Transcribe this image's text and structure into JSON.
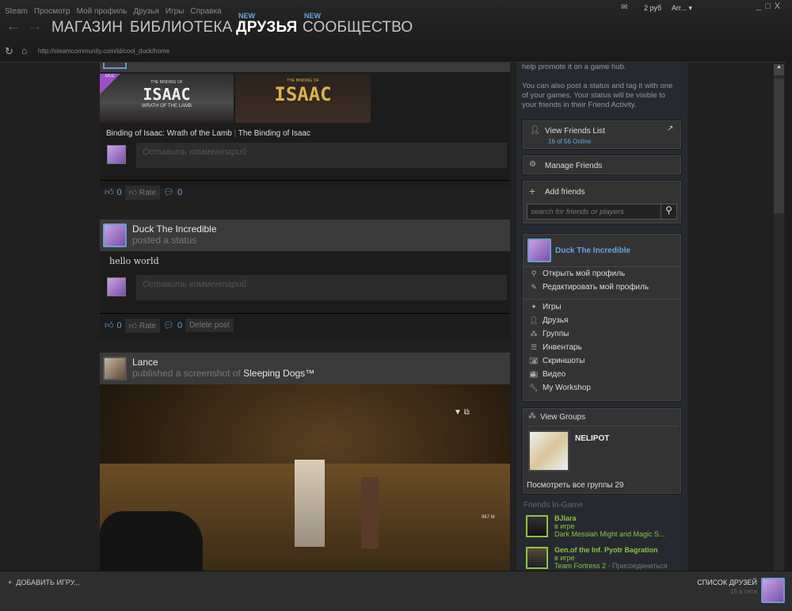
{
  "menu": [
    "Steam",
    "Просмотр",
    "Мой профиль",
    "Друзья",
    "Игры",
    "Справка"
  ],
  "wallet": "2 руб",
  "account": "Arr...",
  "nav": {
    "store": "МАГАЗИН",
    "library": "БИБЛИОТЕКА",
    "friends": "ДРУЗЬЯ",
    "community": "СООБЩЕСТВО",
    "new_badge": "NEW"
  },
  "url": "http://steamcommunity.com/id/cool_duck/home",
  "feed": {
    "post1": {
      "games": [
        "Binding of Isaac: Wrath of the Lamb",
        "The Binding of Isaac"
      ],
      "separator": "|",
      "dlc": "DLC",
      "banner1": "ISAAC",
      "banner1_sub": "WRATH OF THE LAMB",
      "banner2": "ISAAC",
      "banner_top": "THE BINDING OF",
      "comment_placeholder": "Оставить комментарий",
      "likes": "0",
      "rate": "Rate",
      "comments": "0"
    },
    "post2": {
      "author": "Duck The Incredible",
      "action": "posted a status",
      "text": "hello world",
      "comment_placeholder": "Оставить комментарий",
      "likes": "0",
      "rate": "Rate",
      "comments": "0",
      "delete": "Delete post"
    },
    "post3": {
      "author": "Lance",
      "action": "published a screenshot of",
      "game": "Sleeping Dogs™",
      "hud": "967 M"
    }
  },
  "sidebar": {
    "help1": "help promote it on a game hub.",
    "help2": "You can also post a status and tag it with one of your games. Your status will be visible to your friends in their Friend Activity.",
    "view_friends": "View Friends List",
    "online": "16 of 56 Online",
    "manage_friends": "Manage Friends",
    "add_friends": "Add friends",
    "search_placeholder": "search for friends or players",
    "profile_name": "Duck The Incredible",
    "profile_links": [
      "Открыть мой профиль",
      "Редактировать мой профиль"
    ],
    "links": [
      "Игры",
      "Друзья",
      "Группы",
      "Инвентарь",
      "Скриншоты",
      "Видео",
      "My Workshop"
    ],
    "view_groups": "View Groups",
    "group_name": "NELIPOT",
    "all_groups": "Посмотреть все группы 29",
    "friends_ingame": "Friends In-Game",
    "friends": [
      {
        "name": "BJlara",
        "status": "в игре",
        "game": "Dark Messiah Might and Magic S..."
      },
      {
        "name": "Gen.of the Inf. Pyotr Bagration",
        "status": "в игре",
        "game": "Team Fortress 2",
        "join": " - Присоединиться"
      }
    ]
  },
  "bottom": {
    "add_game": "ДОБАВИТЬ ИГРУ...",
    "friends_list": "СПИСОК ДРУЗЕЙ",
    "online": "16 в сети"
  }
}
